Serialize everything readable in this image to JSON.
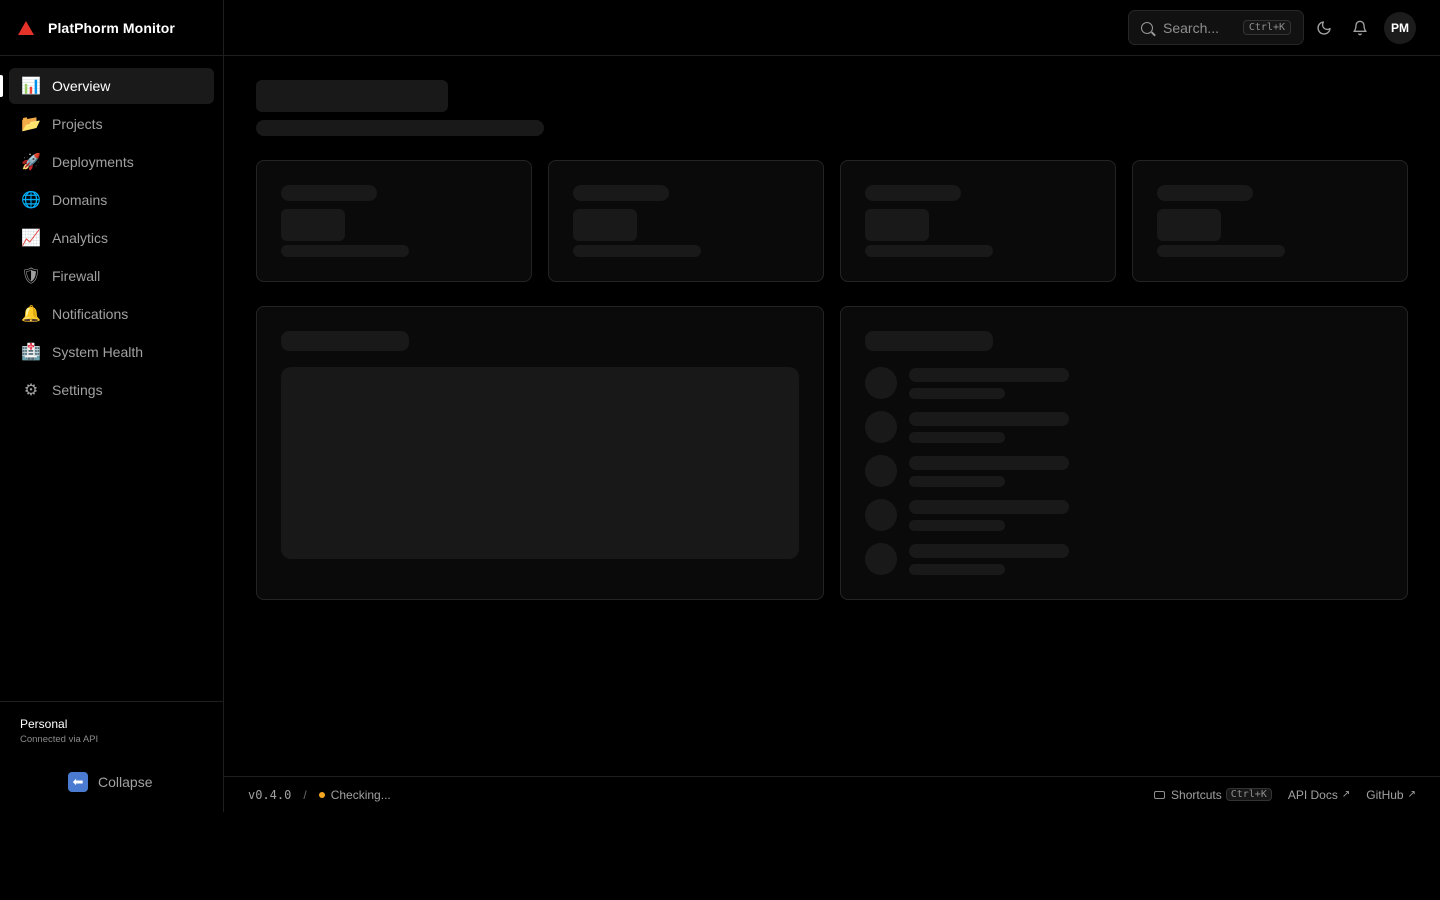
{
  "app": {
    "name": "PlatPhorm Monitor"
  },
  "sidebar": {
    "items": [
      {
        "label": "Overview",
        "icon": "📊",
        "active": true
      },
      {
        "label": "Projects",
        "icon": "📂"
      },
      {
        "label": "Deployments",
        "icon": "🚀"
      },
      {
        "label": "Domains",
        "icon": "🌐"
      },
      {
        "label": "Analytics",
        "icon": "📈"
      },
      {
        "label": "Firewall",
        "icon": "🛡"
      },
      {
        "label": "Notifications",
        "icon": "🔔"
      },
      {
        "label": "System Health",
        "icon": "🏥"
      },
      {
        "label": "Settings",
        "icon": "⚙"
      }
    ],
    "account": {
      "name": "Personal",
      "status": "Connected via API"
    },
    "collapse_label": "Collapse"
  },
  "header": {
    "search_placeholder": "Search...",
    "search_shortcut": "Ctrl+K",
    "avatar_initials": "PM"
  },
  "footer": {
    "version": "v0.4.0",
    "separator": "/",
    "status": "Checking...",
    "status_color": "#f5a623",
    "shortcuts_label": "Shortcuts",
    "shortcuts_key": "Ctrl+K",
    "api_docs_label": "API Docs",
    "github_label": "GitHub"
  },
  "colors": {
    "background": "#000000",
    "brand_accent": "#e5332a",
    "active_indicator": "#ffffff"
  }
}
